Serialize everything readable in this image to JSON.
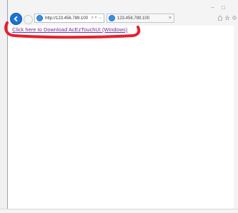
{
  "browser": {
    "address": {
      "url": "http://123.456.789.100",
      "tools": "⌕ ▾ →"
    },
    "tab": {
      "title": "123.456.789.100",
      "close": "×"
    },
    "window_buttons": {
      "minimize": "–",
      "maximize": "□"
    }
  },
  "page": {
    "download_link": "Click here to Download AcEzTouchUI (Windows)"
  },
  "annotation": {
    "highlight_color": "#e8202a"
  }
}
